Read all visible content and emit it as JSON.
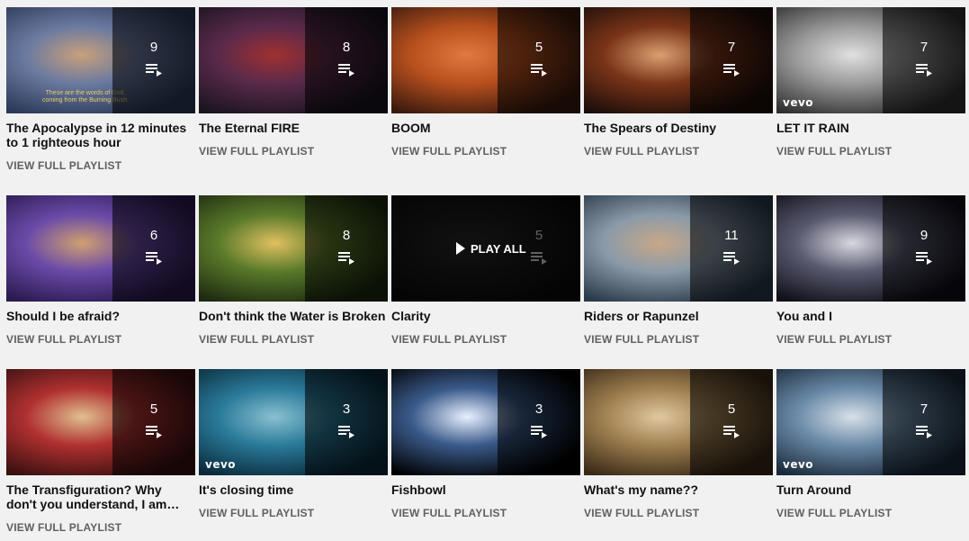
{
  "playlists": [
    {
      "title": "The Apocalypse in 12 minutes to 1 righteous hour",
      "count": "9",
      "action": "VIEW FULL PLAYLIST",
      "caption": "These are the words of God, coming from the Burning Bush.",
      "thumb": [
        "#2b3a58",
        "#6b7aa0",
        "#c9a07a"
      ]
    },
    {
      "title": "The Eternal FIRE",
      "count": "8",
      "action": "VIEW FULL PLAYLIST",
      "thumb": [
        "#1a1420",
        "#5a2a4a",
        "#a03030"
      ]
    },
    {
      "title": "BOOM",
      "count": "5",
      "action": "VIEW FULL PLAYLIST",
      "thumb": [
        "#3a1a0e",
        "#b8501e",
        "#e07a40"
      ]
    },
    {
      "title": "The Spears of Destiny",
      "count": "7",
      "action": "VIEW FULL PLAYLIST",
      "thumb": [
        "#1c0e0a",
        "#7a3418",
        "#d9a070"
      ]
    },
    {
      "title": "LET IT RAIN",
      "count": "7",
      "action": "VIEW FULL PLAYLIST",
      "badge": "vevo",
      "thumb": [
        "#303030",
        "#9a9a9a",
        "#e0e0e0"
      ]
    },
    {
      "title": "Should I be afraid?",
      "count": "6",
      "action": "VIEW FULL PLAYLIST",
      "thumb": [
        "#2a1a50",
        "#6a4aa8",
        "#d0a070"
      ]
    },
    {
      "title": "Don't think the Water is Broken",
      "count": "8",
      "action": "VIEW FULL PLAYLIST",
      "thumb": [
        "#1e2a10",
        "#5a7a2a",
        "#e0c060"
      ]
    },
    {
      "title": "Clarity",
      "count": "5",
      "action": "VIEW FULL PLAYLIST",
      "play_all": "PLAY ALL",
      "thumb": [
        "#101010",
        "#2a2a2a",
        "#404040"
      ]
    },
    {
      "title": "Riders or Rapunzel",
      "count": "11",
      "action": "VIEW FULL PLAYLIST",
      "thumb": [
        "#2a3a4a",
        "#8a9aa8",
        "#c8a888"
      ]
    },
    {
      "title": "You and I",
      "count": "9",
      "action": "VIEW FULL PLAYLIST",
      "thumb": [
        "#101018",
        "#5a5a70",
        "#d8d8e0"
      ]
    },
    {
      "title": "The Transfiguration? Why don't you understand, I am never…",
      "count": "5",
      "action": "VIEW FULL PLAYLIST",
      "thumb": [
        "#3a1010",
        "#b03030",
        "#e0c090"
      ]
    },
    {
      "title": "It's closing time",
      "count": "3",
      "action": "VIEW FULL PLAYLIST",
      "badge": "vevo",
      "thumb": [
        "#0a2a3a",
        "#2a7a9a",
        "#8ac0d0"
      ]
    },
    {
      "title": "Fishbowl",
      "count": "3",
      "action": "VIEW FULL PLAYLIST",
      "thumb": [
        "#000000",
        "#3a5a8a",
        "#e8f0ff"
      ]
    },
    {
      "title": "What's my name??",
      "count": "5",
      "action": "VIEW FULL PLAYLIST",
      "thumb": [
        "#3a2a18",
        "#a08050",
        "#e0c8a0"
      ]
    },
    {
      "title": "Turn Around",
      "count": "7",
      "action": "VIEW FULL PLAYLIST",
      "badge": "vevo",
      "thumb": [
        "#1a2a3a",
        "#6a8aa8",
        "#d8e0e8"
      ]
    }
  ],
  "colors": {
    "background": "#f1f1f1",
    "title": "#111111",
    "action": "#606060",
    "overlay": "rgba(0,0,0,0.58)"
  }
}
